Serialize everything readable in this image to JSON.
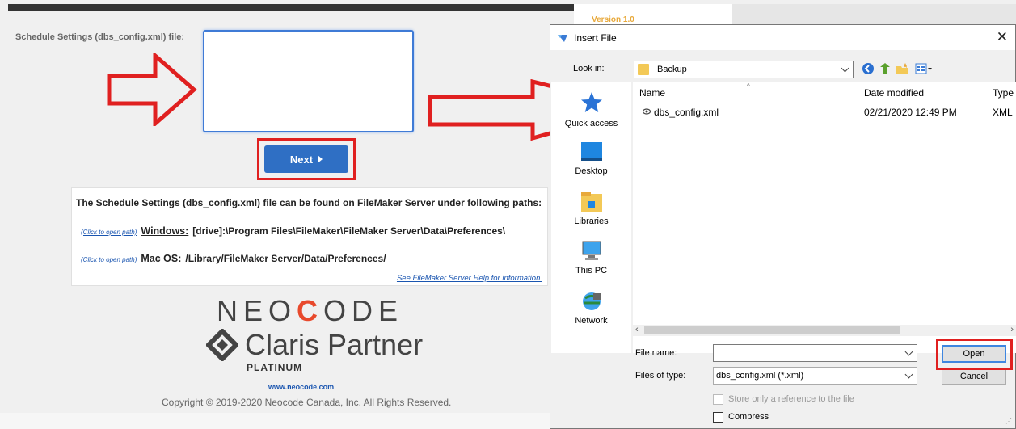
{
  "version": "Version 1.0",
  "form": {
    "settings_label": "Schedule Settings (dbs_config.xml) file:",
    "next_label": "Next"
  },
  "info": {
    "heading": "The Schedule Settings (dbs_config.xml) file can be found on FileMaker Server under following paths:",
    "click_link": "(Click to open path)",
    "windows_label": "Windows:",
    "windows_path": "[drive]:\\Program Files\\FileMaker\\FileMaker Server\\Data\\Preferences\\",
    "mac_label": "Mac OS:",
    "mac_path": "/Library/FileMaker Server/Data/Preferences/",
    "help_link": "See FileMaker Server Help for information."
  },
  "branding": {
    "neocode_pre": "NEO",
    "neocode_c": "C",
    "neocode_post": "ODE",
    "claris_word": "Claris",
    "partner_word": " Partner",
    "platinum": "PLATINUM",
    "website": "www.neocode.com",
    "copyright": "Copyright © 2019-2020 Neocode Canada, Inc. All Rights Reserved."
  },
  "dialog": {
    "title": "Insert File",
    "close_glyph": "✕",
    "look_in_label": "Look in:",
    "look_in_value": "Backup",
    "places": [
      {
        "label": "Quick access",
        "icon": "star-icon"
      },
      {
        "label": "Desktop",
        "icon": "desktop-icon"
      },
      {
        "label": "Libraries",
        "icon": "libraries-icon"
      },
      {
        "label": "This PC",
        "icon": "computer-icon"
      },
      {
        "label": "Network",
        "icon": "network-icon"
      }
    ],
    "columns": {
      "name": "Name",
      "date": "Date modified",
      "type": "Type"
    },
    "files": [
      {
        "name": "dbs_config.xml",
        "date": "02/21/2020 12:49 PM",
        "type": "XML"
      }
    ],
    "file_name_label": "File name:",
    "file_name_value": "",
    "files_of_type_label": "Files of type:",
    "files_of_type_value": "dbs_config.xml (*.xml)",
    "open_label": "Open",
    "cancel_label": "Cancel",
    "store_ref_label": "Store only a reference to the file",
    "compress_label": "Compress"
  },
  "colors": {
    "annotation_red": "#e02020",
    "next_blue": "#2f6fc4",
    "neocode_orange": "#e8492c"
  }
}
